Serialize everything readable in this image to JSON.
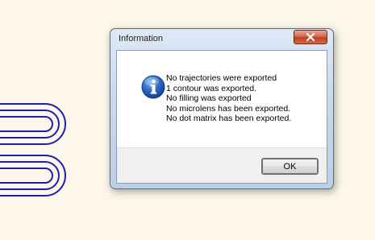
{
  "dialog": {
    "title": "Information",
    "close_icon": "close-x-icon",
    "message_icon": "information-icon",
    "message_lines": [
      "No trajectories were exported",
      "1 contour was exported.",
      "No filling was exported",
      "No microlens has been exported.",
      "No dot matrix has been exported."
    ],
    "ok_label": "OK"
  },
  "background": {
    "shape_icon": "hairpin-contour-icon",
    "shape_color": "#1c1fb0",
    "canvas_color": "#fcf7ea"
  }
}
